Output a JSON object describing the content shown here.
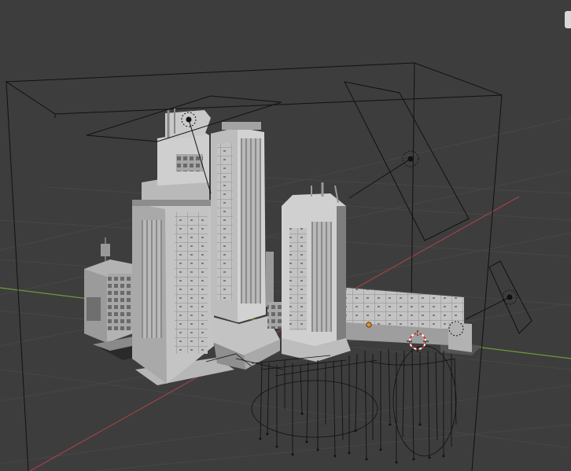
{
  "viewport": {
    "background": "#3d3d3d",
    "grid_color": "#464646",
    "x_axis_color": "#9a4148",
    "y_axis_color": "#6e9a3a",
    "wire_color": "#000000",
    "object_color": "#9c9c9c",
    "origin_color": "#f08a1c",
    "cursor_color": "#cc3333",
    "icons": [
      "light-icon",
      "camera-icon",
      "3d-cursor-icon",
      "origin-icon",
      "navigation-gizmo-icon"
    ]
  }
}
